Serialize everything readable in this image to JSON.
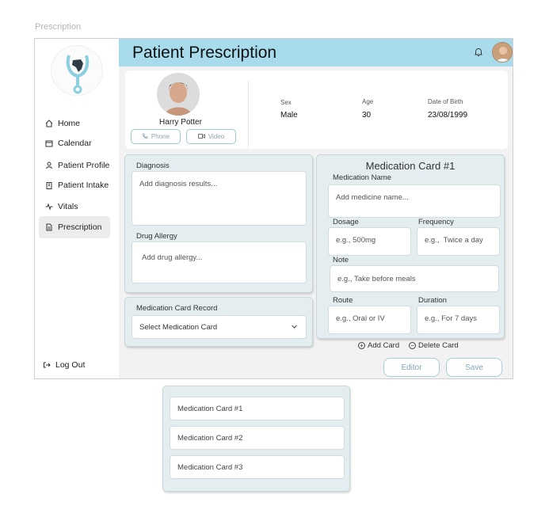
{
  "frame_label": "Prescription",
  "header": {
    "title": "Patient Prescription"
  },
  "sidebar": {
    "items": [
      {
        "label": "Home",
        "icon": "home-icon"
      },
      {
        "label": "Calendar",
        "icon": "calendar-icon"
      },
      {
        "label": "Patient Profile",
        "icon": "user-icon"
      },
      {
        "label": "Patient Intake",
        "icon": "clipboard-icon"
      },
      {
        "label": "Vitals",
        "icon": "pulse-icon"
      },
      {
        "label": "Prescription",
        "icon": "document-icon"
      }
    ],
    "logout_label": "Log Out"
  },
  "patient": {
    "name": "Harry Potter",
    "phone_label": "Phone",
    "video_label": "Video",
    "sex_label": "Sex",
    "sex": "Male",
    "age_label": "Age",
    "age": "30",
    "dob_label": "Date of Birth",
    "dob": "23/08/1999"
  },
  "diagnosis": {
    "label": "Diagnosis",
    "placeholder": "Add diagnosis results...",
    "allergy_label": "Drug Allergy",
    "allergy_placeholder": "Add drug allergy..."
  },
  "record": {
    "label": "Medication Card Record",
    "select_value": "Select Medication Card"
  },
  "medication": {
    "title": "Medication Card #1",
    "name_label": "Medication Name",
    "name_placeholder": "Add medicine name...",
    "dosage_label": "Dosage",
    "dosage_placeholder": "e.g., 500mg",
    "frequency_label": "Frequency",
    "frequency_placeholder": "e.g.,  Twice a day",
    "note_label": "Note",
    "note_placeholder": "e.g., Take before meals",
    "route_label": "Route",
    "route_placeholder": "e.g., Oral or IV",
    "duration_label": "Duration",
    "duration_placeholder": "e.g., For 7 days",
    "add_card": "Add Card",
    "delete_card": "Delete Card"
  },
  "buttons": {
    "editor": "Editor",
    "save": "Save"
  },
  "dropdown_options": [
    "Medication Card #1",
    "Medication Card #2",
    "Medication Card #3"
  ],
  "colors": {
    "header_bg": "#a8dcec",
    "panel_bg": "#e4eef0",
    "accent": "#7fa9b6"
  }
}
